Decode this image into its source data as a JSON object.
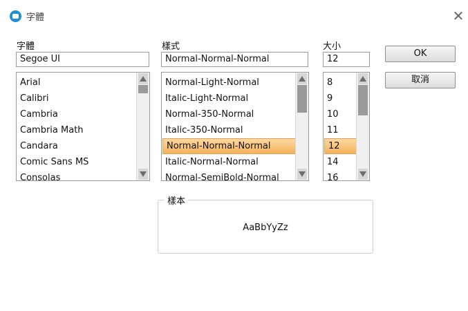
{
  "window": {
    "title": "字體",
    "close_glyph": "✕"
  },
  "font": {
    "label": "字體",
    "value": "Segoe UI",
    "items": [
      "Arial",
      "Calibri",
      "Cambria",
      "Cambria Math",
      "Candara",
      "Comic Sans MS",
      "Consolas"
    ]
  },
  "style": {
    "label": "樣式",
    "value": "Normal-Normal-Normal",
    "items": [
      "Normal-Light-Normal",
      "Italic-Light-Normal",
      "Normal-350-Normal",
      "Italic-350-Normal",
      "Normal-Normal-Normal",
      "Italic-Normal-Normal",
      "Normal-SemiBold-Normal"
    ],
    "selected_index": 4
  },
  "size": {
    "label": "大小",
    "value": "12",
    "items": [
      "8",
      "9",
      "10",
      "11",
      "12",
      "14",
      "16"
    ],
    "selected_index": 4
  },
  "buttons": {
    "ok": "OK",
    "cancel": "取消"
  },
  "sample": {
    "legend": "樣本",
    "text": "AaBbYyZz"
  },
  "colors": {
    "selection": "#f6b25c",
    "accent": "#1f8fd6"
  }
}
